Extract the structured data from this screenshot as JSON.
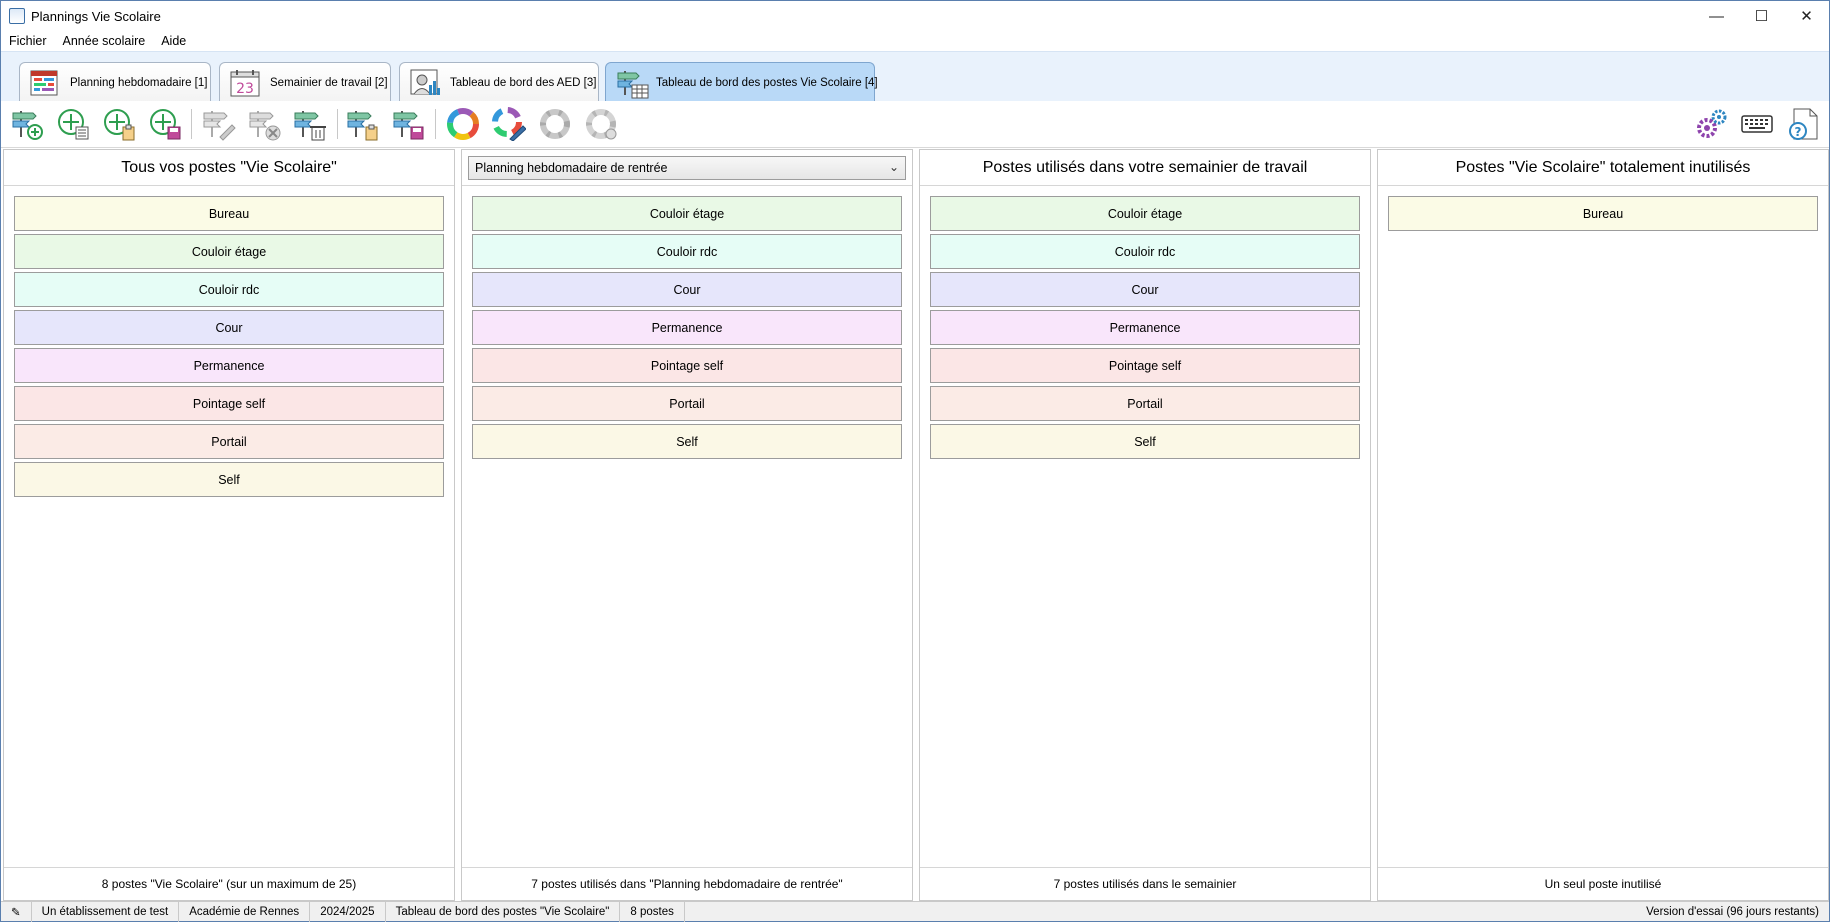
{
  "window": {
    "title": "Plannings Vie Scolaire",
    "minimize": "—",
    "maximize": "☐",
    "close": "✕"
  },
  "menu": [
    "Fichier",
    "Année scolaire",
    "Aide"
  ],
  "tabs": [
    {
      "label": "Planning hebdomadaire [1]",
      "icon": "weekly-planning-icon"
    },
    {
      "label": "Semainier de travail [2]",
      "icon": "calendar-23-icon"
    },
    {
      "label": "Tableau de bord des AED [3]",
      "icon": "aed-dashboard-icon"
    },
    {
      "label": "Tableau de bord des postes Vie Scolaire [4]",
      "icon": "signpost-dashboard-icon",
      "active": true
    }
  ],
  "panels": {
    "all_posts": {
      "title": "Tous vos postes \"Vie Scolaire\"",
      "items": [
        "Bureau",
        "Couloir étage",
        "Couloir rdc",
        "Cour",
        "Permanence",
        "Pointage self",
        "Portail",
        "Self"
      ],
      "footer": "8 postes \"Vie Scolaire\" (sur un maximum de 25)"
    },
    "planning_posts": {
      "select_value": "Planning hebdomadaire de rentrée",
      "items": [
        "Couloir étage",
        "Couloir rdc",
        "Cour",
        "Permanence",
        "Pointage self",
        "Portail",
        "Self"
      ],
      "footer": "7 postes utilisés dans \"Planning hebdomadaire de rentrée\""
    },
    "semainier_posts": {
      "title": "Postes utilisés dans votre semainier de travail",
      "items": [
        "Couloir étage",
        "Couloir rdc",
        "Cour",
        "Permanence",
        "Pointage self",
        "Portail",
        "Self"
      ],
      "footer": "7 postes utilisés dans le semainier"
    },
    "unused_posts": {
      "title": "Postes \"Vie Scolaire\" totalement inutilisés",
      "items": [
        "Bureau"
      ],
      "footer": "Un seul poste inutilisé"
    }
  },
  "post_colors": {
    "Bureau": "#fbfbe6",
    "Couloir étage": "#e9f9e6",
    "Couloir rdc": "#e6fdf6",
    "Cour": "#e6e6fb",
    "Permanence": "#f9e6fb",
    "Pointage self": "#fbe6e6",
    "Portail": "#fbebe6",
    "Self": "#fbf8e6"
  },
  "status": {
    "etablissement": "Un établissement de test",
    "academie": "Académie de Rennes",
    "annee": "2024/2025",
    "vue": "Tableau de bord des postes \"Vie Scolaire\"",
    "count": "8 postes",
    "version": "Version d'essai (96 jours restants)"
  }
}
